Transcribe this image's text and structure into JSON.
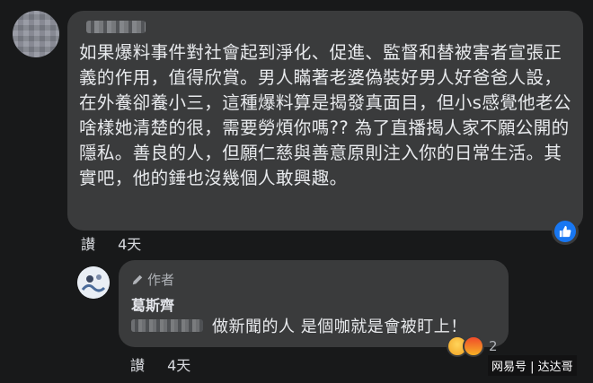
{
  "main_comment": {
    "text": "如果爆料事件對社會起到淨化、促進、監督和替被害者宣張正義的作用，值得欣賞。男人瞞著老婆偽裝好男人好爸爸人設，在外養卻養小三，這種爆料算是揭發真面目，但小s感覺他老公啥樣她清楚的很，需要勞煩你嗎?? 為了直播揭人家不願公開的隱私。善良的人，但願仁慈與善意原則注入你的日常生活。其實吧，他的錘也沒幾個人敢興趣。",
    "reaction_icon": "like-icon",
    "like_color": "#1877f2"
  },
  "main_actions": {
    "reply_label": "讃",
    "time": "4天"
  },
  "reply": {
    "author_badge": "作者",
    "name": "葛斯齊",
    "text": "做新聞的人 是個咖就是會被盯上！",
    "reactions": [
      "haha-icon",
      "angry-icon"
    ],
    "reaction_count": "2"
  },
  "reply_actions": {
    "reply_label": "讃",
    "time": "4天"
  },
  "watermark": "网易号 | 达达哥"
}
